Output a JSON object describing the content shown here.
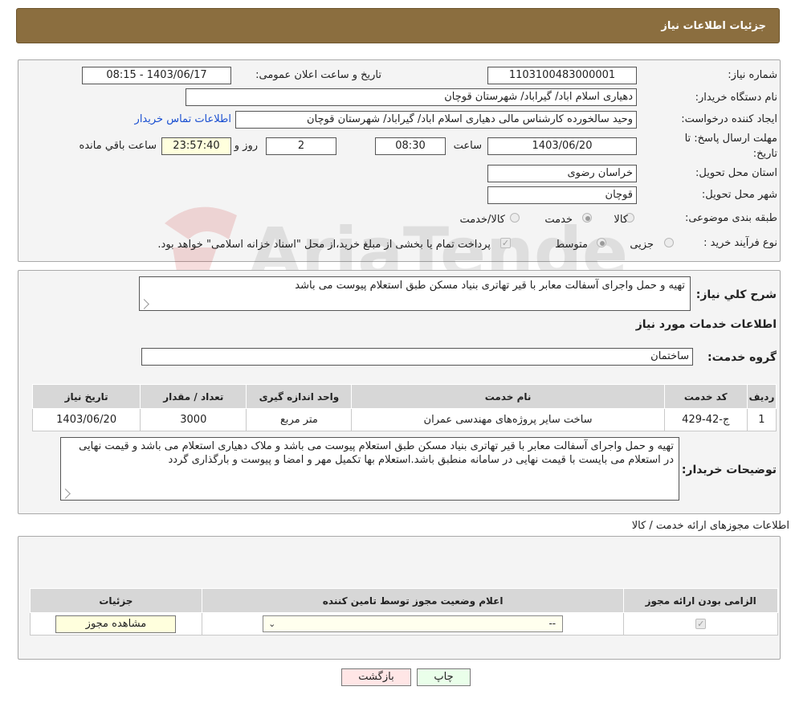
{
  "header": {
    "title": "جزئیات اطلاعات نیاز"
  },
  "form": {
    "need_number_label": "شماره نیاز:",
    "need_number": "1103100483000001",
    "announce_label": "تاریخ و ساعت اعلان عمومی:",
    "announce_value": "1403/06/17 - 08:15",
    "buyer_org_label": "نام دستگاه خریدار:",
    "buyer_org": "دهیاری اسلام اباد/ گیراباد/ شهرستان قوچان",
    "requester_label": "ایجاد کننده درخواست:",
    "requester": "وحید سالخورده کارشناس مالی دهیاری اسلام اباد/ گیراباد/ شهرستان قوچان",
    "contact_link": "اطلاعات تماس خریدار",
    "deadline_label_1": "مهلت ارسال پاسخ: تا",
    "deadline_label_2": "تاریخ:",
    "deadline_date": "1403/06/20",
    "time_label": "ساعت",
    "deadline_time": "08:30",
    "days_value": "2",
    "days_label": "روز و",
    "remaining_time": "23:57:40",
    "remaining_label": "ساعت باقي مانده",
    "province_label": "استان محل تحویل:",
    "province": "خراسان رضوی",
    "city_label": "شهر محل تحویل:",
    "city": "قوچان",
    "category_label": "طبقه بندی موضوعی:",
    "category_options": [
      "کالا",
      "خدمت",
      "کالا/خدمت"
    ],
    "process_label": "نوع فرآیند خرید :",
    "process_options": [
      "جزیی",
      "متوسط"
    ],
    "payment_note": "پرداخت تمام یا بخشی از مبلغ خرید،از محل \"اسناد خزانه اسلامی\" خواهد بود."
  },
  "summary": {
    "label": "شرح کلي نياز:",
    "text": "تهیه و حمل واجرای آسفالت معابر با قیر تهاتری بنیاد مسکن طبق استعلام پیوست می باشد",
    "services_heading": "اطلاعات خدمات مورد نياز",
    "service_group_label": "گروه خدمت:",
    "service_group": "ساختمان"
  },
  "services_table": {
    "headers": [
      "رديف",
      "کد خدمت",
      "نام خدمت",
      "واحد اندازه گیری",
      "تعداد / مقدار",
      "تاریخ نیاز"
    ],
    "rows": [
      [
        "1",
        "ج-42-429",
        "ساخت سایر پروژه‌های مهندسی عمران",
        "متر مربع",
        "3000",
        "1403/06/20"
      ]
    ]
  },
  "buyer_notes": {
    "label": "توضيحات خريدار:",
    "text": "تهیه و حمل واجرای آسفالت معابر با قیر تهاتری بنیاد مسکن طبق استعلام پیوست می باشد و ملاک دهیاری استعلام می باشد و قیمت نهایی در استعلام می بایست با قیمت نهایی در سامانه منطبق باشد.استعلام بها تکمیل مهر و امضا و پیوست و بارگذاری گردد"
  },
  "licenses": {
    "heading": "اطلاعات مجوزهای ارائه خدمت / کالا",
    "headers": [
      "الزامی بودن ارائه مجوز",
      "اعلام وضعیت مجوز توسط تامین کننده",
      "جزئیات"
    ],
    "select_value": "--",
    "view_button": "مشاهده مجوز"
  },
  "footer": {
    "print_button": "چاپ",
    "back_button": "بازگشت"
  },
  "watermark": {
    "text": "AriaTender.neT"
  },
  "colors": {
    "header_bg": "#8b6e3f",
    "remaining_bg": "#ffffdd",
    "back_bg": "#ffe6e6",
    "print_bg": "#eaffea",
    "link": "#1a4fd1"
  }
}
